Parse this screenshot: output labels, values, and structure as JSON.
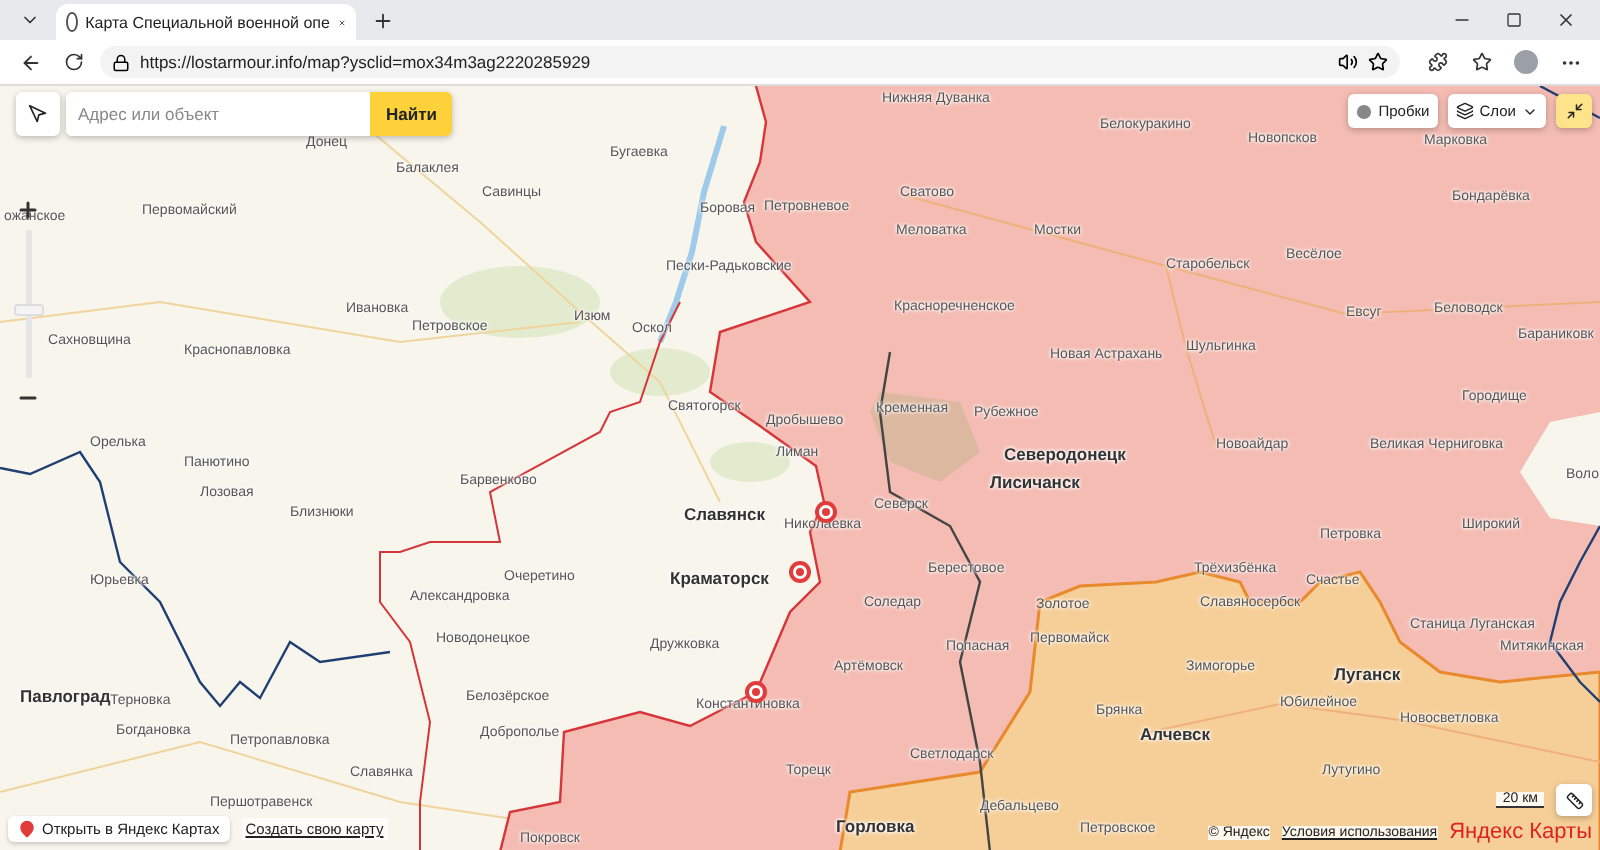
{
  "browser": {
    "tab_title": "Карта Специальной военной опе",
    "url": "https://lostarmour.info/map?ysclid=mox34m3ag2220285929"
  },
  "map": {
    "search": {
      "placeholder": "Адрес или объект",
      "button": "Найти"
    },
    "controls": [
      "Пробки",
      "Слои"
    ],
    "zoom": {
      "level": 0.45
    },
    "places": [
      {
        "name": "Нижняя Дуванка",
        "kind": "town"
      },
      {
        "name": "Донец",
        "kind": "town"
      },
      {
        "name": "Белокуракино",
        "kind": "town"
      },
      {
        "name": "Новопсков",
        "kind": "town"
      },
      {
        "name": "Марковка",
        "kind": "town"
      },
      {
        "name": "Бугаевка",
        "kind": "town"
      },
      {
        "name": "Балаклея",
        "kind": "town"
      },
      {
        "name": "Савинцы",
        "kind": "town"
      },
      {
        "name": "Сватово",
        "kind": "town"
      },
      {
        "name": "Бондарёвка",
        "kind": "town"
      },
      {
        "name": "ожанское",
        "kind": "town"
      },
      {
        "name": "Первомайский",
        "kind": "town"
      },
      {
        "name": "Боровая",
        "kind": "town"
      },
      {
        "name": "Петровневое",
        "kind": "town"
      },
      {
        "name": "Меловатка",
        "kind": "town"
      },
      {
        "name": "Мостки",
        "kind": "town"
      },
      {
        "name": "Пески-Радьковские",
        "kind": "town"
      },
      {
        "name": "Старобельск",
        "kind": "town"
      },
      {
        "name": "Весёлое",
        "kind": "town"
      },
      {
        "name": "Ивановка",
        "kind": "town"
      },
      {
        "name": "Изюм",
        "kind": "town"
      },
      {
        "name": "Красноречненское",
        "kind": "town"
      },
      {
        "name": "Евсуг",
        "kind": "town"
      },
      {
        "name": "Беловодск",
        "kind": "town"
      },
      {
        "name": "Сахновщина",
        "kind": "town"
      },
      {
        "name": "Краснопавловка",
        "kind": "town"
      },
      {
        "name": "Петровское",
        "kind": "town"
      },
      {
        "name": "Оскол",
        "kind": "town"
      },
      {
        "name": "Новая Астрахань",
        "kind": "town"
      },
      {
        "name": "Шульгинка",
        "kind": "town"
      },
      {
        "name": "Бараниковк",
        "kind": "town"
      },
      {
        "name": "Святогорск",
        "kind": "town"
      },
      {
        "name": "Дробышево",
        "kind": "town"
      },
      {
        "name": "Кременная",
        "kind": "town"
      },
      {
        "name": "Рубежное",
        "kind": "town"
      },
      {
        "name": "Городище",
        "kind": "town"
      },
      {
        "name": "Орелька",
        "kind": "town"
      },
      {
        "name": "Панютино",
        "kind": "town"
      },
      {
        "name": "Лиман",
        "kind": "town"
      },
      {
        "name": "Северодонецк",
        "kind": "city"
      },
      {
        "name": "Новоайдар",
        "kind": "town"
      },
      {
        "name": "Великая Черниговка",
        "kind": "town"
      },
      {
        "name": "Барвенково",
        "kind": "town"
      },
      {
        "name": "Лисичанск",
        "kind": "city"
      },
      {
        "name": "Воло",
        "kind": "town"
      },
      {
        "name": "Лозовая",
        "kind": "town"
      },
      {
        "name": "Близнюки",
        "kind": "town"
      },
      {
        "name": "Славянск",
        "kind": "city"
      },
      {
        "name": "Северск",
        "kind": "town"
      },
      {
        "name": "Николаевка",
        "kind": "town"
      },
      {
        "name": "Петровка",
        "kind": "town"
      },
      {
        "name": "Широкий",
        "kind": "town"
      },
      {
        "name": "Юрьевка",
        "kind": "town"
      },
      {
        "name": "Очеретино",
        "kind": "town"
      },
      {
        "name": "Краматорск",
        "kind": "city"
      },
      {
        "name": "Берестовое",
        "kind": "town"
      },
      {
        "name": "Трёхизбёнка",
        "kind": "town"
      },
      {
        "name": "Счастье",
        "kind": "town"
      },
      {
        "name": "Александровка",
        "kind": "town"
      },
      {
        "name": "Соледар",
        "kind": "town"
      },
      {
        "name": "Золотое",
        "kind": "town"
      },
      {
        "name": "Славяносербск",
        "kind": "town"
      },
      {
        "name": "Новодонецкое",
        "kind": "town"
      },
      {
        "name": "Дружковка",
        "kind": "town"
      },
      {
        "name": "Попасная",
        "kind": "town"
      },
      {
        "name": "Первомайск",
        "kind": "town"
      },
      {
        "name": "Станица Луганская",
        "kind": "town"
      },
      {
        "name": "Митякинская",
        "kind": "town"
      },
      {
        "name": "Артёмовск",
        "kind": "town"
      },
      {
        "name": "Зимогорье",
        "kind": "town"
      },
      {
        "name": "Луганск",
        "kind": "city"
      },
      {
        "name": "Павлоград",
        "kind": "city"
      },
      {
        "name": "Терновка",
        "kind": "town"
      },
      {
        "name": "Белозёрское",
        "kind": "town"
      },
      {
        "name": "Константиновка",
        "kind": "town"
      },
      {
        "name": "Брянка",
        "kind": "town"
      },
      {
        "name": "Юбилейное",
        "kind": "town"
      },
      {
        "name": "Богдановка",
        "kind": "town"
      },
      {
        "name": "Петропавловка",
        "kind": "town"
      },
      {
        "name": "Доброполье",
        "kind": "town"
      },
      {
        "name": "Алчевск",
        "kind": "city"
      },
      {
        "name": "Новосветловка",
        "kind": "town"
      },
      {
        "name": "Светлодарск",
        "kind": "town"
      },
      {
        "name": "Славянка",
        "kind": "town"
      },
      {
        "name": "Торецк",
        "kind": "town"
      },
      {
        "name": "Лутугино",
        "kind": "town"
      },
      {
        "name": "Першотравенск",
        "kind": "town"
      },
      {
        "name": "Дебальцево",
        "kind": "town"
      },
      {
        "name": "Покровск",
        "kind": "town"
      },
      {
        "name": "Горловка",
        "kind": "city"
      },
      {
        "name": "Петровское",
        "kind": "town"
      }
    ],
    "footer_links": [
      "Открыть в Яндекс Картах",
      "Создать свою карту"
    ],
    "scale": "20 км",
    "attribution": {
      "copyright": "© Яндекс",
      "terms": "Условия использования",
      "logo": "Яндекс Карты"
    }
  }
}
